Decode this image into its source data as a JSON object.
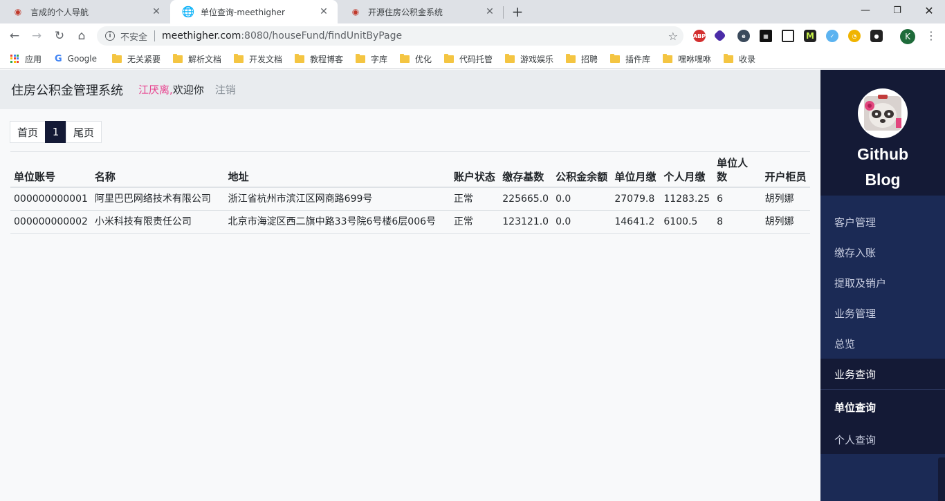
{
  "browser": {
    "tabs": [
      {
        "title": "言成的个人导航",
        "active": false
      },
      {
        "title": "单位查询-meethigher",
        "active": true
      },
      {
        "title": "开源住房公积金系统",
        "active": false
      }
    ],
    "address": {
      "security_label": "不安全",
      "host": "meethigher.com",
      "path": ":8080/houseFund/findUnitByPage"
    },
    "profile_initial": "K",
    "bookmarks": [
      "应用",
      "Google",
      "无关紧要",
      "解析文档",
      "开发文档",
      "教程博客",
      "字库",
      "优化",
      "代码托管",
      "游戏娱乐",
      "招聘",
      "插件库",
      "嘿咻嘿咻",
      "收录"
    ]
  },
  "header": {
    "title": "住房公积金管理系统",
    "user": "江厌离,",
    "welcome": "欢迎你",
    "logout": "注销"
  },
  "pagination": {
    "first": "首页",
    "current": "1",
    "last": "尾页"
  },
  "table": {
    "columns": [
      "单位账号",
      "名称",
      "地址",
      "账户状态",
      "缴存基数",
      "公积金余额",
      "单位月缴",
      "个人月缴",
      "单位人数",
      "开户柜员"
    ],
    "rows": [
      [
        "000000000001",
        "阿里巴巴网络技术有限公司",
        "浙江省杭州市滨江区网商路699号",
        "正常",
        "225665.0",
        "0.0",
        "27079.8",
        "11283.25",
        "6",
        "胡列娜"
      ],
      [
        "000000000002",
        "小米科技有限责任公司",
        "北京市海淀区西二旗中路33号院6号楼6层006号",
        "正常",
        "123121.0",
        "0.0",
        "14641.2",
        "6100.5",
        "8",
        "胡列娜"
      ]
    ]
  },
  "sidebar": {
    "blog_title": "Github Blog",
    "menu": [
      "客户管理",
      "缴存入账",
      "提取及销户",
      "业务管理",
      "总览",
      "业务查询"
    ],
    "submenu": [
      "单位查询",
      "个人查询"
    ]
  },
  "colors": {
    "sidebar_bg": "#1b2a55",
    "sidebar_dark": "#141a36",
    "user_name": "#e83e8c",
    "header_bg": "#e9ecef"
  }
}
